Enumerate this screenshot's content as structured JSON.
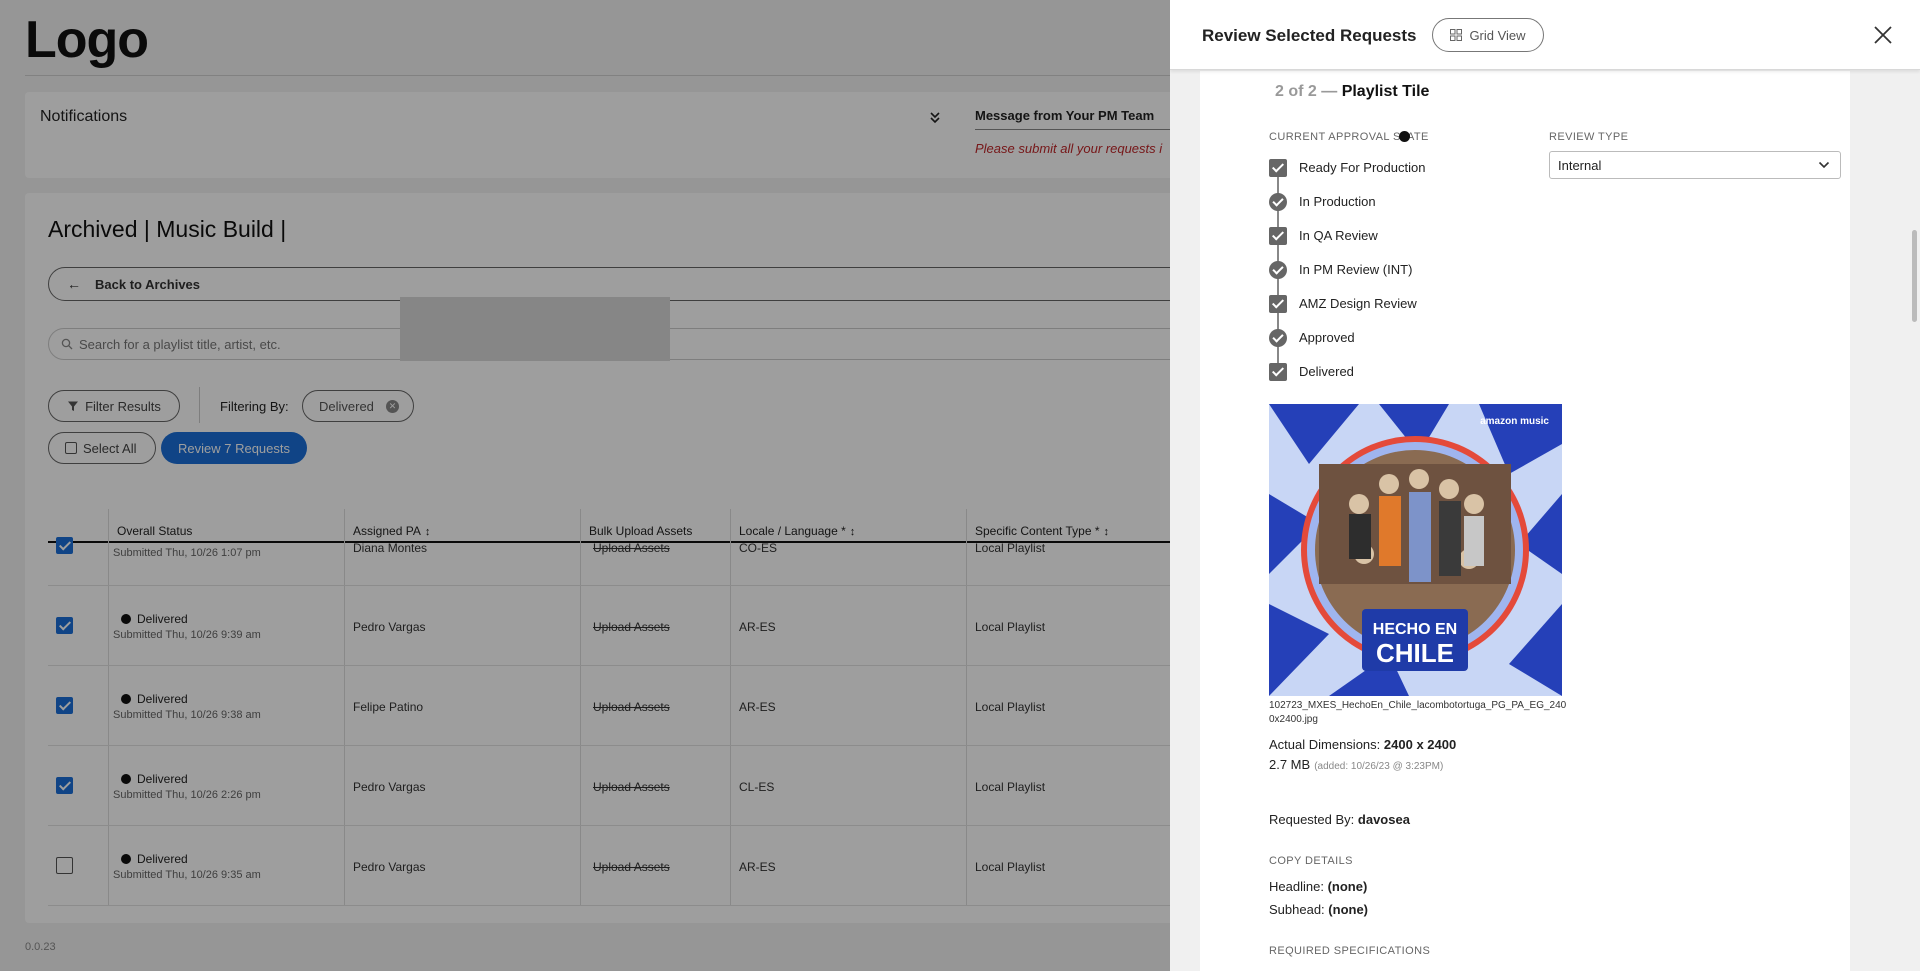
{
  "app": {
    "logo": "Logo",
    "notifications": {
      "title": "Notifications",
      "message_title": "Message from Your PM Team",
      "message_text": "Please submit all your requests i"
    },
    "page_title": "Archived | Music Build |",
    "back_label": "Back to Archives",
    "search_placeholder": "Search for a playlist title, artist, etc.",
    "filter_label": "Filter Results",
    "filtering_by_label": "Filtering By:",
    "filter_chip": "Delivered",
    "select_all_label": "Select All",
    "review_button_label": "Review 7 Requests",
    "version": "0.0.23",
    "table": {
      "headers": [
        "Overall Status",
        "Assigned PA",
        "Bulk Upload Assets",
        "Locale / Language *",
        "Specific Content Type *"
      ],
      "rows": [
        {
          "checked": true,
          "status": "",
          "submitted": "Submitted Thu, 10/26 1:07 pm",
          "pa": "Diana Montes",
          "assets": "Upload Assets",
          "locale": "CO-ES",
          "type": "Local Playlist"
        },
        {
          "checked": true,
          "status": "Delivered",
          "submitted": "Submitted Thu, 10/26 9:39 am",
          "pa": "Pedro Vargas",
          "assets": "Upload Assets",
          "locale": "AR-ES",
          "type": "Local Playlist"
        },
        {
          "checked": true,
          "status": "Delivered",
          "submitted": "Submitted Thu, 10/26 9:38 am",
          "pa": "Felipe Patino",
          "assets": "Upload Assets",
          "locale": "AR-ES",
          "type": "Local Playlist"
        },
        {
          "checked": true,
          "status": "Delivered",
          "submitted": "Submitted Thu, 10/26 2:26 pm",
          "pa": "Pedro Vargas",
          "assets": "Upload Assets",
          "locale": "CL-ES",
          "type": "Local Playlist"
        },
        {
          "checked": false,
          "status": "Delivered",
          "submitted": "Submitted Thu, 10/26 9:35 am",
          "pa": "Pedro Vargas",
          "assets": "Upload Assets",
          "locale": "AR-ES",
          "type": "Local Playlist"
        }
      ]
    }
  },
  "drawer": {
    "title": "Review Selected Requests",
    "grid_view_label": "Grid View",
    "item_counter": "2 of 2 —",
    "item_title": "Playlist Tile",
    "approval_state_label": "CURRENT APPROVAL STATE",
    "review_type_label": "REVIEW TYPE",
    "review_type_value": "Internal",
    "steps": [
      {
        "label": "Ready For Production",
        "marker": "box"
      },
      {
        "label": "In Production",
        "marker": "circle"
      },
      {
        "label": "In QA Review",
        "marker": "box"
      },
      {
        "label": "In PM Review (INT)",
        "marker": "circle"
      },
      {
        "label": "AMZ Design Review",
        "marker": "box"
      },
      {
        "label": "Approved",
        "marker": "circle"
      },
      {
        "label": "Delivered",
        "marker": "box"
      }
    ],
    "artwork": {
      "brand": "amazon music",
      "line1": "HECHO EN",
      "line2": "CHILE"
    },
    "filename": "102723_MXES_HechoEn_Chile_lacombotortuga_PG_PA_EG_2400x2400.jpg",
    "dimensions_label": "Actual Dimensions:",
    "dimensions_value": "2400 x 2400",
    "file_size": "2.7 MB",
    "added": "(added: 10/26/23 @ 3:23PM)",
    "requested_by_label": "Requested By:",
    "requested_by_value": "davosea",
    "copy_details_label": "COPY DETAILS",
    "headline_label": "Headline:",
    "headline_value": "(none)",
    "subhead_label": "Subhead:",
    "subhead_value": "(none)",
    "required_specs_label": "REQUIRED SPECIFICATIONS"
  },
  "colors": {
    "accent": "#1a6fd8",
    "warning_text": "#c0282b"
  }
}
